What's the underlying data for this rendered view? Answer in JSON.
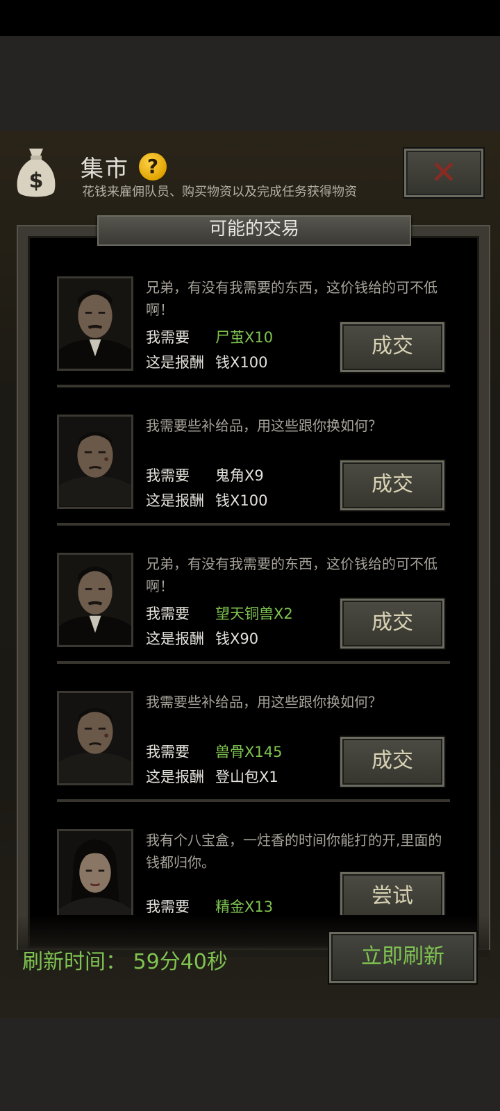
{
  "header": {
    "title": "集市",
    "help_glyph": "?",
    "subtitle": "花钱来雇佣队员、购买物资以及完成任务获得物资",
    "close_glyph": "✕",
    "bag_glyph": "$"
  },
  "section": {
    "title": "可能的交易"
  },
  "trades": [
    {
      "message": "兄弟，有没有我需要的东西，这价钱给的可不低啊！",
      "need_label": "我需要",
      "need_value": "尸茧X10",
      "need_color": "#7fc451",
      "reward_label": "这是报酬",
      "reward_value": "钱X100",
      "button": "成交",
      "portrait": "man-mustache-portrait"
    },
    {
      "message": "我需要些补给品，用这些跟你换如何？",
      "need_label": "我需要",
      "need_value": "鬼角X9",
      "need_color": "#e4e2dc",
      "reward_label": "这是报酬",
      "reward_value": "钱X100",
      "button": "成交",
      "portrait": "man-bruised-portrait"
    },
    {
      "message": "兄弟，有没有我需要的东西，这价钱给的可不低啊！",
      "need_label": "我需要",
      "need_value": "望天铜兽X2",
      "need_color": "#7fc451",
      "reward_label": "这是报酬",
      "reward_value": "钱X90",
      "button": "成交",
      "portrait": "man-mustache-portrait"
    },
    {
      "message": "我需要些补给品，用这些跟你换如何？",
      "need_label": "我需要",
      "need_value": "兽骨X145",
      "need_color": "#7fc451",
      "reward_label": "这是报酬",
      "reward_value": "登山包X1",
      "button": "成交",
      "portrait": "man-bruised-portrait"
    },
    {
      "message": "我有个八宝盒，一炷香的时间你能打的开,里面的钱都归你。",
      "need_label": "我需要",
      "need_value": "精金X13",
      "need_color": "#7fc451",
      "reward_label": "",
      "reward_value": "",
      "button": "尝试",
      "portrait": "woman-portrait"
    }
  ],
  "footer": {
    "refresh_text": "刷新时间：  59分40秒",
    "refresh_button": "立即刷新"
  },
  "colors": {
    "accent_green": "#7fc451",
    "close_red": "#8b2a22",
    "help_gold": "#e0a400"
  }
}
